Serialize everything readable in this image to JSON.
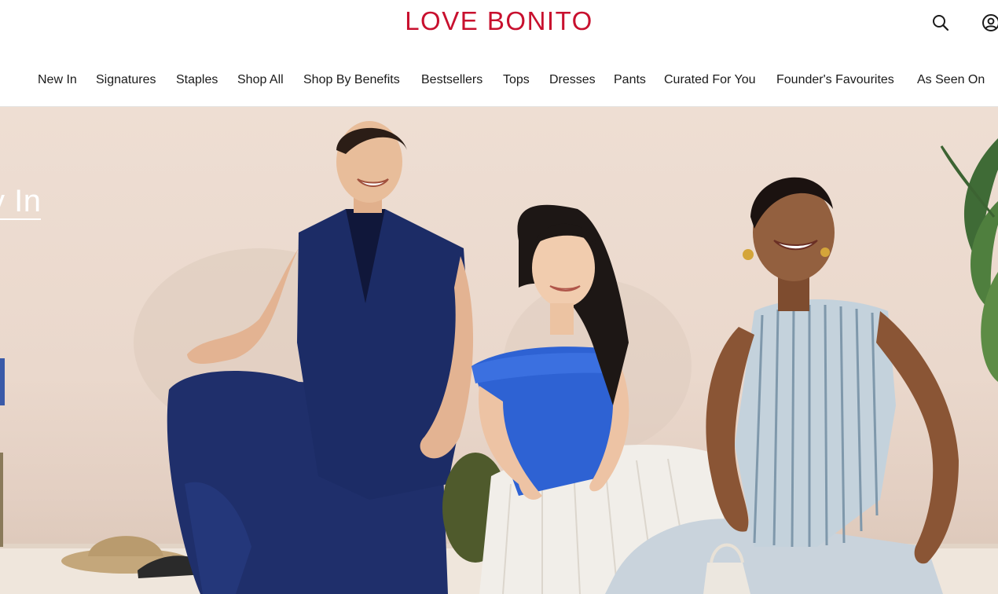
{
  "brand": {
    "name": "LOVE BONITO",
    "color": "#c8102e"
  },
  "header": {
    "search_icon": "search-icon",
    "account_icon": "account-icon"
  },
  "nav": {
    "items": [
      {
        "label": "New In"
      },
      {
        "label": "Signatures"
      },
      {
        "label": "Staples"
      },
      {
        "label": "Shop All"
      },
      {
        "label": "Shop By Benefits"
      },
      {
        "label": "Bestsellers"
      },
      {
        "label": "Tops"
      },
      {
        "label": "Dresses"
      },
      {
        "label": "Pants"
      },
      {
        "label": "Curated For You"
      },
      {
        "label": "Founder's Favourites"
      },
      {
        "label": "As Seen On"
      }
    ]
  },
  "hero": {
    "caption": "y In",
    "image": "three-women-laughing-photo"
  }
}
